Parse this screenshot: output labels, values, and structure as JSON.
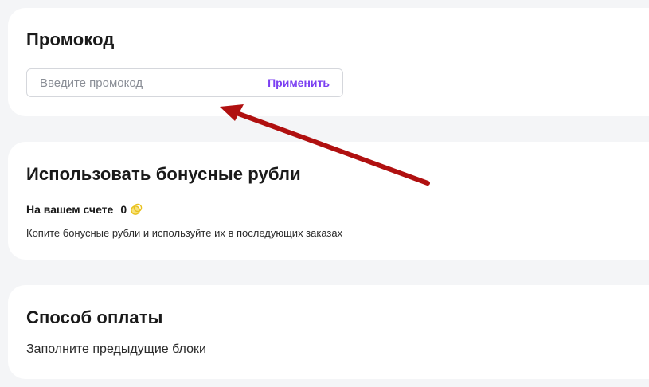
{
  "promo": {
    "title": "Промокод",
    "input_placeholder": "Введите промокод",
    "input_value": "",
    "apply_label": "Применить"
  },
  "bonus": {
    "title": "Использовать бонусные рубли",
    "balance_label": "На вашем счете",
    "balance_value": "0",
    "hint": "Копите бонусные рубли и используйте их в последующих заказах",
    "coin_icon": "coin-icon"
  },
  "payment": {
    "title": "Способ оплаты",
    "hint": "Заполните предыдущие блоки"
  },
  "colors": {
    "accent": "#7b3ff2",
    "background": "#f4f5f7",
    "card": "#ffffff",
    "annotation_arrow": "#b01010",
    "coin": "#f5d23a"
  }
}
